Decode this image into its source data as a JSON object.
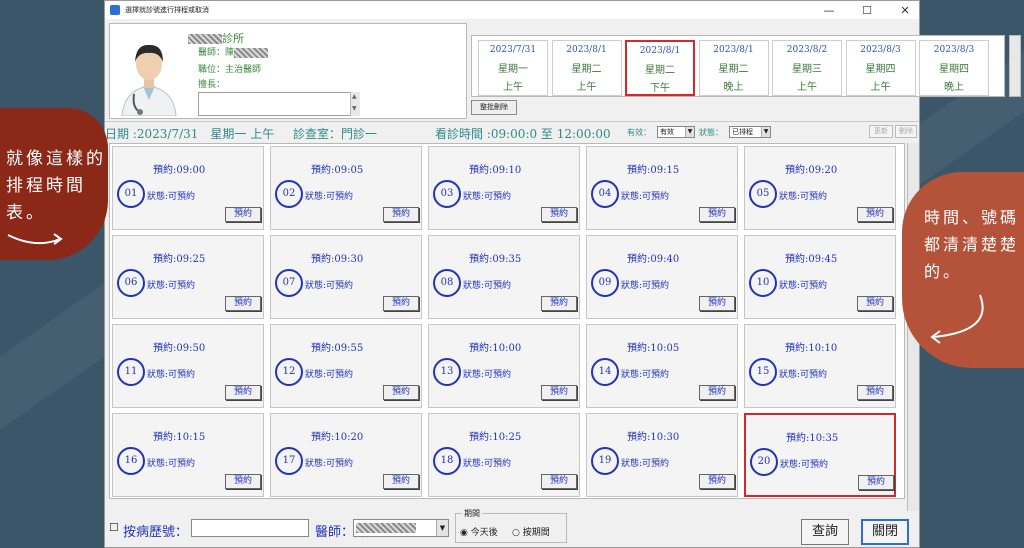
{
  "window": {
    "title": "選擇就診號進行排程或取消",
    "min": "—",
    "max": "☐",
    "close": "✕"
  },
  "doctor": {
    "clinic_suffix": "診所",
    "doctor_label": "醫師：陳",
    "title_label": "職位：主治醫師",
    "skill_label": "擅長："
  },
  "dates": [
    {
      "date": "2023/7/31",
      "weekday": "星期一",
      "session": "上午"
    },
    {
      "date": "2023/8/1",
      "weekday": "星期二",
      "session": "上午"
    },
    {
      "date": "2023/8/1",
      "weekday": "星期二",
      "session": "下午"
    },
    {
      "date": "2023/8/1",
      "weekday": "星期二",
      "session": "晚上"
    },
    {
      "date": "2023/8/2",
      "weekday": "星期三",
      "session": "上午"
    },
    {
      "date": "2023/8/3",
      "weekday": "星期四",
      "session": "上午"
    },
    {
      "date": "2023/8/3",
      "weekday": "星期四",
      "session": "晚上"
    }
  ],
  "batch_button": "整批刪除",
  "info": {
    "date_text": "日期 :2023/7/31　星期一 上午",
    "room_text": "診查室：門診一",
    "time_text": "看診時間 :09:00:0 至 12:00:00",
    "valid_label": "有效：",
    "valid_value": "有效",
    "status_label": "狀態：",
    "status_value": "已排程",
    "update_btn": "更新",
    "delete_btn": "刪除"
  },
  "slots": [
    {
      "no": "01",
      "time": "預約:09:00",
      "status": "狀態:可預約",
      "btn": "預約"
    },
    {
      "no": "02",
      "time": "預約:09:05",
      "status": "狀態:可預約",
      "btn": "預約"
    },
    {
      "no": "03",
      "time": "預約:09:10",
      "status": "狀態:可預約",
      "btn": "預約"
    },
    {
      "no": "04",
      "time": "預約:09:15",
      "status": "狀態:可預約",
      "btn": "預約"
    },
    {
      "no": "05",
      "time": "預約:09:20",
      "status": "狀態:可預約",
      "btn": "預約"
    },
    {
      "no": "06",
      "time": "預約:09:25",
      "status": "狀態:可預約",
      "btn": "預約"
    },
    {
      "no": "07",
      "time": "預約:09:30",
      "status": "狀態:可預約",
      "btn": "預約"
    },
    {
      "no": "08",
      "time": "預約:09:35",
      "status": "狀態:可預約",
      "btn": "預約"
    },
    {
      "no": "09",
      "time": "預約:09:40",
      "status": "狀態:可預約",
      "btn": "預約"
    },
    {
      "no": "10",
      "time": "預約:09:45",
      "status": "狀態:可預約",
      "btn": "預約"
    },
    {
      "no": "11",
      "time": "預約:09:50",
      "status": "狀態:可預約",
      "btn": "預約"
    },
    {
      "no": "12",
      "time": "預約:09:55",
      "status": "狀態:可預約",
      "btn": "預約"
    },
    {
      "no": "13",
      "time": "預約:10:00",
      "status": "狀態:可預約",
      "btn": "預約"
    },
    {
      "no": "14",
      "time": "預約:10:05",
      "status": "狀態:可預約",
      "btn": "預約"
    },
    {
      "no": "15",
      "time": "預約:10:10",
      "status": "狀態:可預約",
      "btn": "預約"
    },
    {
      "no": "16",
      "time": "預約:10:15",
      "status": "狀態:可預約",
      "btn": "預約"
    },
    {
      "no": "17",
      "time": "預約:10:20",
      "status": "狀態:可預約",
      "btn": "預約"
    },
    {
      "no": "18",
      "time": "預約:10:25",
      "status": "狀態:可預約",
      "btn": "預約"
    },
    {
      "no": "19",
      "time": "預約:10:30",
      "status": "狀態:可預約",
      "btn": "預約"
    },
    {
      "no": "20",
      "time": "預約:10:35",
      "status": "狀態:可預約",
      "btn": "預約"
    }
  ],
  "bottom": {
    "chart_label": "按病歷號：",
    "doctor_label": "醫師：陳",
    "period_legend": "期間",
    "radio_today": "今天後",
    "radio_range": "按期間",
    "query_btn": "查詢",
    "close_btn": "關閉"
  },
  "annotations": {
    "left": "就像這樣的排程時間表。",
    "right": "時間、號碼都清清楚楚的。"
  }
}
